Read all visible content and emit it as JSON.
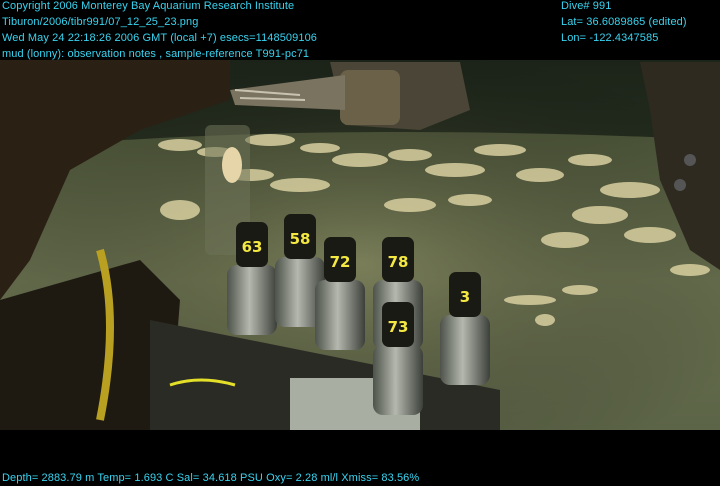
{
  "overlay": {
    "text_color": "#38d4f0",
    "top_left": [
      "Copyright 2006 Monterey Bay Aquarium Research Institute",
      "Tiburon/2006/tibr991/07_12_25_23.png",
      "Wed May 24 22:18:26 2006 GMT (local +7)  esecs=1148509106",
      "mud (lonny): observation notes , sample-reference T991-pc71"
    ],
    "top_right": [
      "Dive# 991",
      "Lat= 36.6089865 (edited)",
      "Lon= -122.4347585"
    ],
    "bottom": "Depth= 2883.79 m  Temp= 1.693 C  Sal= 34.618 PSU  Oxy= 2.28 ml/l  Xmiss= 83.56%"
  },
  "scene": {
    "core_labels": [
      "63",
      "58",
      "72",
      "78",
      "3",
      "73"
    ],
    "colors": {
      "seafloor": "#5b6446",
      "water": "#2a3326",
      "clams": "#d8cfa0",
      "core_cap": "#1a1a14",
      "core_ring": "#8a8f86",
      "label_yellow": "#f4e842"
    }
  }
}
